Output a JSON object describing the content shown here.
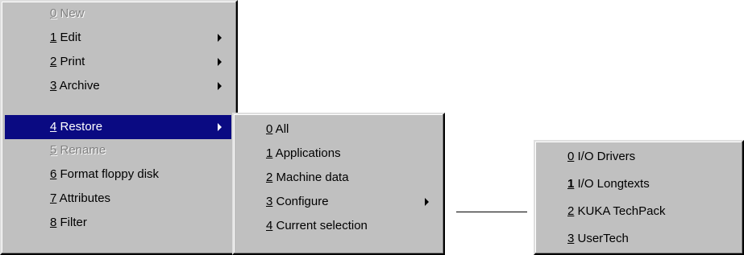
{
  "main_menu": {
    "items": [
      {
        "key": "0",
        "label": " New",
        "disabled": true,
        "submenu": false
      },
      {
        "key": "1",
        "label": " Edit",
        "disabled": false,
        "submenu": true
      },
      {
        "key": "2",
        "label": " Print",
        "disabled": false,
        "submenu": true
      },
      {
        "key": "3",
        "label": " Archive",
        "disabled": false,
        "submenu": true
      },
      {
        "key": "4",
        "label": " Restore",
        "disabled": false,
        "submenu": true,
        "highlighted": true
      },
      {
        "key": "5",
        "label": " Rename",
        "disabled": true,
        "submenu": false
      },
      {
        "key": "6",
        "label": " Format floppy disk",
        "disabled": false,
        "submenu": false
      },
      {
        "key": "7",
        "label": " Attributes",
        "disabled": false,
        "submenu": false
      },
      {
        "key": "8",
        "label": " Filter",
        "disabled": false,
        "submenu": false
      }
    ]
  },
  "restore_submenu": {
    "items": [
      {
        "key": "0",
        "label": " All",
        "submenu": false
      },
      {
        "key": "1",
        "label": " Applications",
        "submenu": false
      },
      {
        "key": "2",
        "label": " Machine data",
        "submenu": false
      },
      {
        "key": "3",
        "label": " Configure",
        "submenu": true
      },
      {
        "key": "4",
        "label": " Current selection",
        "submenu": false
      }
    ]
  },
  "configure_submenu": {
    "items": [
      {
        "key": "0",
        "label": " I/O Drivers"
      },
      {
        "key": "1",
        "label": " I/O Longtexts"
      },
      {
        "key": "2",
        "label": " KUKA TechPack"
      },
      {
        "key": "3",
        "label": " UserTech"
      }
    ]
  },
  "colors": {
    "menu_background": "#c0c0c0",
    "highlight": "#0a0a82",
    "disabled_text": "#808080"
  }
}
